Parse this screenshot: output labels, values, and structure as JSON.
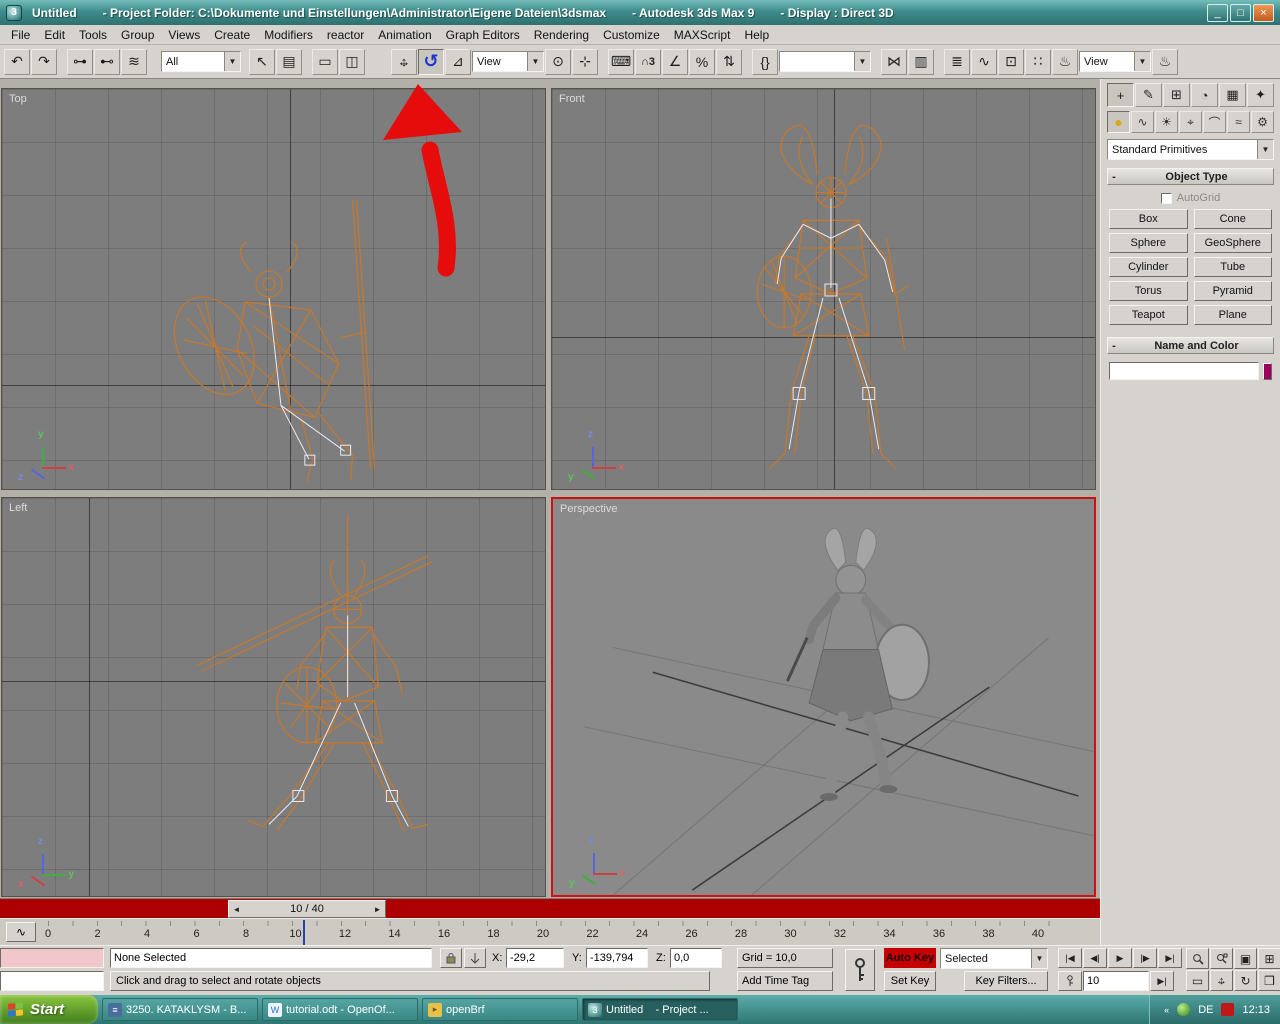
{
  "titlebar": {
    "segments": [
      "Untitled",
      "- Project Folder: C:\\Dokumente und Einstellungen\\Administrator\\Eigene Dateien\\3dsmax",
      "- Autodesk 3ds Max 9",
      "- Display : Direct 3D"
    ],
    "minimize": "_",
    "maximize": "□",
    "close": "×"
  },
  "menu": {
    "items": [
      "File",
      "Edit",
      "Tools",
      "Group",
      "Views",
      "Create",
      "Modifiers",
      "reactor",
      "Animation",
      "Graph Editors",
      "Rendering",
      "Customize",
      "MAXScript",
      "Help"
    ]
  },
  "toolbar": {
    "selection_filter": "All",
    "coord_system": "View",
    "render_type": "View",
    "named_selection": "",
    "icons": {
      "dd_arrow": "▼",
      "undo": "↶",
      "redo": "↷",
      "link": "⊶",
      "unlink": "⊷",
      "bind": "≋",
      "select": "↖",
      "select_by_name": "▤",
      "rect_region": "▭",
      "window_crossing": "◫",
      "move_h": "↔",
      "move_v": "↕",
      "rotate": "↺",
      "scale": "⊿",
      "use_center": "⊙",
      "manipulate": "⊹",
      "kbd_override": "⌨",
      "snap3d": "∩3",
      "angle_snap": "∠",
      "percent_snap": "%",
      "spinner_snap": "⇅",
      "named_sets": "{}",
      "mirror": "⋈",
      "align": "▥",
      "layers": "≣",
      "curve_editor": "∿",
      "schematic": "⊡",
      "material": "∷",
      "render_setup": "♨",
      "quick_render": "♨"
    }
  },
  "panel": {
    "tabs": [
      {
        "name": "create",
        "glyph": "+"
      },
      {
        "name": "modify",
        "glyph": "✎"
      },
      {
        "name": "hierarchy",
        "glyph": "⊞"
      },
      {
        "name": "motion",
        "glyph": "◔"
      },
      {
        "name": "display",
        "glyph": "▦"
      },
      {
        "name": "utilities",
        "glyph": "✦"
      }
    ],
    "categories": [
      {
        "name": "geometry",
        "glyph": "●"
      },
      {
        "name": "shapes",
        "glyph": "∿"
      },
      {
        "name": "lights",
        "glyph": "☀"
      },
      {
        "name": "cameras",
        "glyph": "⌖"
      },
      {
        "name": "helpers",
        "glyph": "⌒"
      },
      {
        "name": "space-warps",
        "glyph": "≈"
      },
      {
        "name": "systems",
        "glyph": "⚙"
      }
    ],
    "primitives_dropdown": "Standard Primitives",
    "object_type_rollout": "Object Type",
    "autogrid": "AutoGrid",
    "object_buttons": [
      "Box",
      "Cone",
      "Sphere",
      "GeoSphere",
      "Cylinder",
      "Tube",
      "Torus",
      "Pyramid",
      "Teapot",
      "Plane"
    ],
    "name_color_rollout": "Name and Color",
    "name_value": "",
    "swatch_color": "#9b005e"
  },
  "viewports": {
    "top": {
      "label": "Top"
    },
    "front": {
      "label": "Front"
    },
    "left": {
      "label": "Left"
    },
    "perspective": {
      "label": "Perspective"
    },
    "axis": {
      "x": "x",
      "y": "y",
      "z": "z"
    },
    "wire_color": "#c8782a",
    "bone_color": "#eaeaf2",
    "active_border": "#d01010"
  },
  "timeline": {
    "slider_label": "10 / 40",
    "prev": "◄",
    "next": "►",
    "mini_curve_glyph": "∿",
    "current_frame": "10",
    "ticks": [
      "0",
      "2",
      "4",
      "6",
      "8",
      "10",
      "12",
      "14",
      "16",
      "18",
      "20",
      "22",
      "24",
      "26",
      "28",
      "30",
      "32",
      "34",
      "36",
      "38",
      "40"
    ]
  },
  "status": {
    "selection": "None Selected",
    "prompt": "Click and drag to select and rotate objects",
    "x_label": "X:",
    "x_value": "-29,2",
    "y_label": "Y:",
    "y_value": "-139,794",
    "z_label": "Z:",
    "z_value": "0,0",
    "grid": "Grid = 10,0",
    "add_time_tag": "Add Time Tag",
    "auto_key": "Auto Key",
    "set_key": "Set Key",
    "key_filter_scope": "Selected",
    "key_filters": "Key Filters...",
    "frame": "10",
    "playback": {
      "go_start": "|◀",
      "prev_frame": "◀|",
      "play": "▶",
      "next_frame": "|▶",
      "go_end": "▶|",
      "next_key": "▶|"
    }
  },
  "taskbar": {
    "start": "Start",
    "tasks": [
      {
        "label": "3250. KATAKLYSM - B..."
      },
      {
        "label": "tutorial.odt - OpenOf..."
      },
      {
        "label": "openBrf"
      },
      {
        "label": "Untitled    - Project ..."
      }
    ],
    "tray": {
      "lang": "DE",
      "time": "12:13"
    }
  },
  "colors": {
    "autokey_red": "#c40000",
    "track_red": "#ac0000",
    "wireframe_orange": "#c8782a",
    "annotation_red": "#e60c0c",
    "titlebar_teal": "#3f8d8c"
  }
}
